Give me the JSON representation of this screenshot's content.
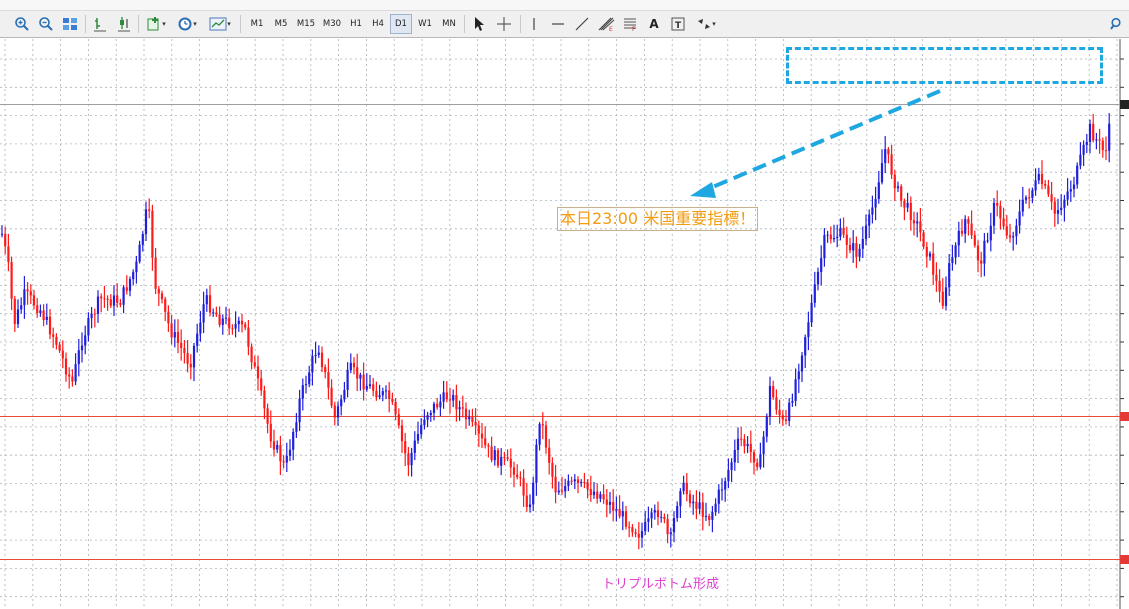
{
  "toolbar": {
    "timeframes": [
      "M1",
      "M5",
      "M15",
      "M30",
      "H1",
      "H4",
      "D1",
      "W1",
      "MN"
    ],
    "active_timeframe": "D1",
    "text_tool_label": "A",
    "icons": [
      "zoom-in-icon",
      "zoom-out-icon",
      "tile-windows-icon",
      "bar-chart-icon",
      "candlestick-icon",
      "add-indicator-icon",
      "period-clock-icon",
      "template-icon",
      "cursor-icon",
      "crosshair-icon",
      "vertical-line-icon",
      "horizontal-line-icon",
      "trendline-icon",
      "fibonacci-icon",
      "channel-icon",
      "text-icon",
      "text-label-icon",
      "arrows-icon",
      "search-icon"
    ]
  },
  "chart": {
    "bull_color": "#1f1fdc",
    "bear_color": "#ff1a1a",
    "grid_color": "#aab4bd",
    "support_color": "#e74c3c",
    "annotation_text": "本日23:00 米国重要指標！",
    "annotation_color": "#f39c12",
    "arrow_color": "#1ea7e1",
    "bottom_label": "トリプルボトム形成",
    "bottom_label_color": "#e040d0"
  }
}
